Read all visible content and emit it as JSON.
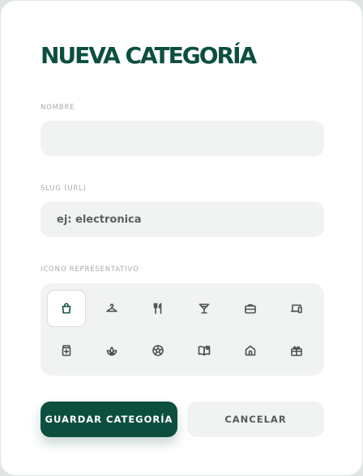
{
  "header": {
    "title": "NUEVA CATEGORÍA"
  },
  "form": {
    "name": {
      "label": "NOMBRE",
      "value": "",
      "placeholder": ""
    },
    "slug": {
      "label": "SLUG (URL)",
      "value": "",
      "placeholder": "ej: electronica"
    },
    "icon_picker": {
      "label": "ICONO REPRESENTATIVO",
      "selected": "shopping-bag",
      "icons": [
        "shopping-bag",
        "hanger",
        "utensils",
        "cocktail",
        "briefcase",
        "devices",
        "medicine",
        "leaf",
        "soccer-ball",
        "book-open",
        "home",
        "gift"
      ]
    }
  },
  "actions": {
    "save_label": "GUARDAR CATEGORÍA",
    "cancel_label": "CANCELAR"
  },
  "colors": {
    "primary": "#0c4f3f",
    "field_bg": "#f1f3f2",
    "icon_stroke": "#4a524f",
    "selected_icon_stroke": "#0c4f3f",
    "cancel_text": "#555c59",
    "label_text": "#a6acaa"
  }
}
